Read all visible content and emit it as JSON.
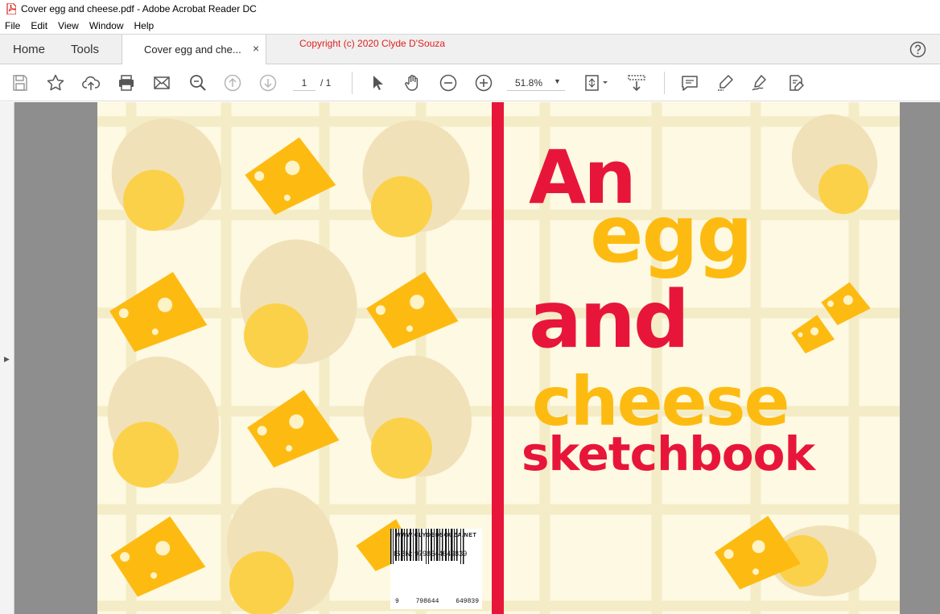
{
  "window": {
    "title": "Cover egg and cheese.pdf - Adobe Acrobat Reader DC",
    "app_icon": "acrobat-pdf-icon"
  },
  "menu": [
    "File",
    "Edit",
    "View",
    "Window",
    "Help"
  ],
  "tabs": {
    "home": "Home",
    "tools": "Tools",
    "document": "Cover egg and che...",
    "close_glyph": "×"
  },
  "copyright": "Copyright (c) 2020 Clyde D'Souza",
  "toolbar": {
    "page_current": "1",
    "page_total": "/ 1",
    "zoom": "51.8%",
    "icons": [
      "save-icon",
      "bookmark-star-icon",
      "upload-icon",
      "print-icon",
      "email-icon",
      "search-zoom-icon",
      "page-up-icon",
      "page-down-icon",
      "select-arrow-icon",
      "hand-tool-icon",
      "zoom-out-icon",
      "zoom-in-icon",
      "fit-page-icon",
      "scroll-mode-icon",
      "comment-icon",
      "highlight-icon",
      "sign-icon",
      "fill-sign-icon"
    ]
  },
  "cover": {
    "title_line1": "An",
    "title_line2": "egg",
    "title_line3": "and",
    "title_line4": "cheese",
    "title_line5": "sketchbook",
    "website": "WWW.CLYDEDSOUZA.NET",
    "isbn": "ISBN: 9798644649839",
    "barcode_digits": [
      "9",
      "798644",
      "649839"
    ],
    "colors": {
      "red": "#e8153a",
      "yellow": "#fdbb12",
      "background": "#fdf9e2",
      "egg_white": "#f1e1b8",
      "yolk": "#fcd14a"
    }
  }
}
